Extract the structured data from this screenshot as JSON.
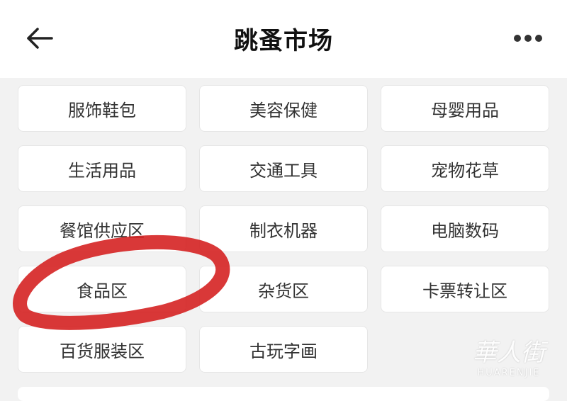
{
  "header": {
    "title": "跳蚤市场",
    "back_icon": "back-arrow-icon",
    "more_icon": "more-dots-icon"
  },
  "categories": [
    [
      "服饰鞋包",
      "美容保健",
      "母婴用品"
    ],
    [
      "生活用品",
      "交通工具",
      "宠物花草"
    ],
    [
      "餐馆供应区",
      "制衣机器",
      "电脑数码"
    ],
    [
      "食品区",
      "杂货区",
      "卡票转让区"
    ],
    [
      "百货服装区",
      "古玩字画"
    ]
  ],
  "annotation": {
    "color": "#d41d1d"
  },
  "watermark": {
    "cn": "華人街",
    "en": "HUARENJIE"
  },
  "colors": {
    "background": "#f2f2f2",
    "card": "#ffffff",
    "text": "#333333"
  }
}
